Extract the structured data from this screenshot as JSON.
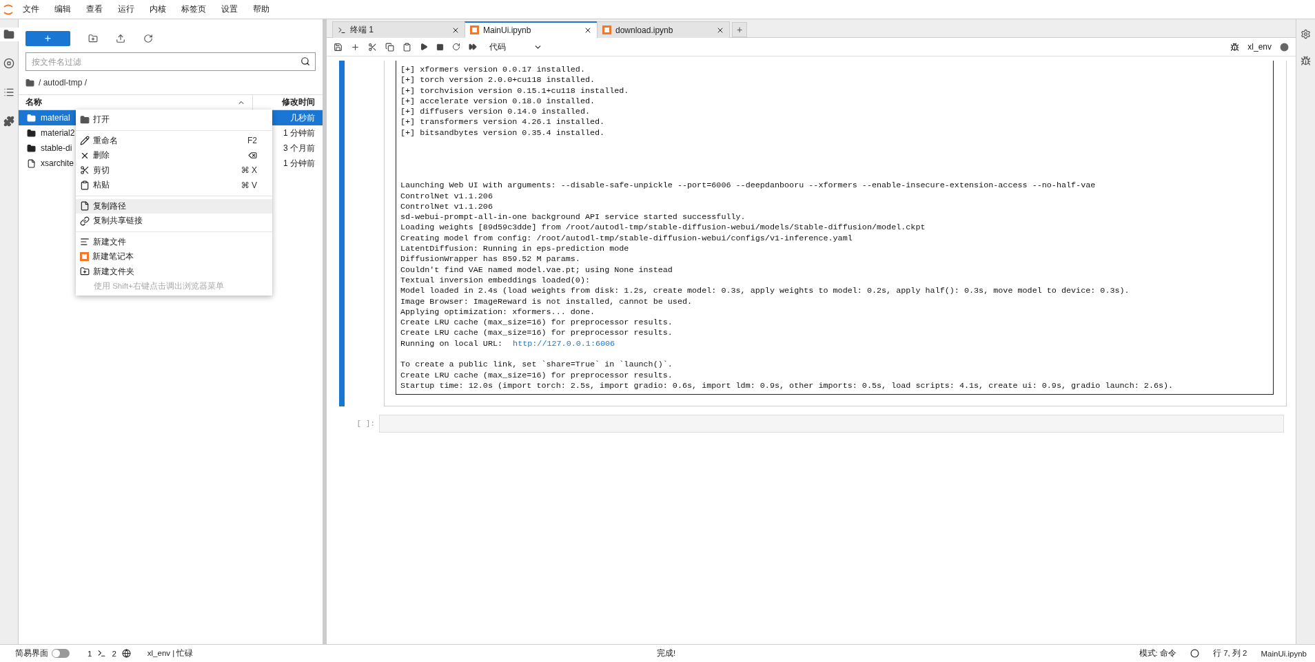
{
  "menu_bar": [
    "文件",
    "编辑",
    "查看",
    "运行",
    "内核",
    "标签页",
    "设置",
    "帮助"
  ],
  "left_sidebar": [
    {
      "kind": "files",
      "selected": true
    },
    {
      "kind": "running",
      "selected": false
    },
    {
      "kind": "toc",
      "selected": false
    },
    {
      "kind": "extensions",
      "selected": false
    }
  ],
  "file_browser": {
    "new_button": "+",
    "filter": {
      "placeholder": "按文件名过滤"
    },
    "breadcrumb": "/ autodl-tmp /",
    "columns": [
      "名称",
      "修改时间"
    ],
    "rows": [
      {
        "name": "material",
        "time": "几秒前",
        "kind": "folder",
        "selected": true
      },
      {
        "name": "material2",
        "time": "1 分钟前",
        "kind": "folder",
        "selected": false
      },
      {
        "name": "stable-di",
        "time": "3 个月前",
        "kind": "folder",
        "selected": false
      },
      {
        "name": "xsarchite",
        "time": "1 分钟前",
        "kind": "file",
        "selected": false
      }
    ]
  },
  "context_menu": {
    "groups": [
      [
        {
          "kind": "open",
          "label": "打开",
          "highlighted": false
        }
      ],
      [
        {
          "kind": "rename",
          "label": "重命名",
          "shortcut": "F2",
          "highlighted": false
        },
        {
          "kind": "delete",
          "label": "删除",
          "highlighted": false
        },
        {
          "kind": "cut",
          "label": "剪切",
          "shortcut": "⌘ X",
          "highlighted": false
        },
        {
          "kind": "paste",
          "label": "粘贴",
          "shortcut": "⌘ V",
          "highlighted": false
        }
      ],
      [
        {
          "kind": "copy-path",
          "label": "复制路径",
          "highlighted": true
        },
        {
          "kind": "share-link",
          "label": "复制共享链接",
          "highlighted": false
        }
      ],
      [
        {
          "kind": "new-file",
          "label": "新建文件",
          "highlighted": false
        },
        {
          "kind": "new-notebook",
          "label": "新建笔记本",
          "highlighted": false
        },
        {
          "kind": "new-folder",
          "label": "新建文件夹",
          "highlighted": false
        }
      ]
    ],
    "hint": "使用 Shift+右键点击调出浏览器菜单"
  },
  "tabs": [
    {
      "label": "终端 1",
      "kind": "terminal",
      "selected": false
    },
    {
      "label": "MainUi.ipynb",
      "kind": "notebook",
      "selected": true
    },
    {
      "label": "download.ipynb",
      "kind": "notebook",
      "selected": false
    }
  ],
  "new_tab_button": "+",
  "notebook_toolbar": {
    "cell_type": "代码",
    "kernel": "xl_env",
    "kernel_busy": true
  },
  "output_blocks": [
    {
      "lines": [
        {
          "text": "[+] xformers version 0.0.17 installed."
        },
        {
          "text": "[+] torch version 2.0.0+cu118 installed."
        },
        {
          "text": "[+] torchvision version 0.15.1+cu118 installed."
        },
        {
          "text": "[+] accelerate version 0.18.0 installed."
        },
        {
          "text": "[+] diffusers version 0.14.0 installed."
        },
        {
          "text": "[+] transformers version 4.26.1 installed."
        },
        {
          "text": "[+] bitsandbytes version 0.35.4 installed."
        }
      ]
    },
    {
      "lines": [
        {
          "text": "Launching Web UI with arguments: --disable-safe-unpickle --port=6006 --deepdanbooru --xformers --enable-insecure-extension-access --no-half-vae"
        },
        {
          "text": "ControlNet v1.1.206"
        },
        {
          "text": "ControlNet v1.1.206"
        },
        {
          "text": "sd-webui-prompt-all-in-one background API service started successfully."
        },
        {
          "text": "Loading weights [89d59c3dde] from /root/autodl-tmp/stable-diffusion-webui/models/Stable-diffusion/model.ckpt"
        },
        {
          "text": "Creating model from config: /root/autodl-tmp/stable-diffusion-webui/configs/v1-inference.yaml"
        },
        {
          "text": "LatentDiffusion: Running in eps-prediction mode"
        },
        {
          "text": "DiffusionWrapper has 859.52 M params."
        },
        {
          "text": "Couldn't find VAE named model.vae.pt; using None instead"
        },
        {
          "text": "Textual inversion embeddings loaded(0):"
        },
        {
          "text": "Model loaded in 2.4s (load weights from disk: 1.2s, create model: 0.3s, apply weights to model: 0.2s, apply half(): 0.3s, move model to device: 0.3s)."
        },
        {
          "text": "Image Browser: ImageReward is not installed, cannot be used."
        },
        {
          "text": "Applying optimization: xformers... done."
        },
        {
          "text": "Create LRU cache (max_size=16) for preprocessor results."
        },
        {
          "text": "Create LRU cache (max_size=16) for preprocessor results."
        },
        {
          "text": "Running on local URL:",
          "link": "http://127.0.0.1:6006"
        }
      ]
    },
    {
      "lines": [
        {
          "text": "To create a public link, set `share=True` in `launch()`."
        },
        {
          "text": "Create LRU cache (max_size=16) for preprocessor results."
        },
        {
          "text": "Startup time: 12.0s (import torch: 2.5s, import gradio: 0.6s, import ldm: 0.9s, other imports: 0.5s, load scripts: 4.1s, create ui: 0.9s, gradio launch: 2.6s)."
        }
      ]
    }
  ],
  "empty_cell": {
    "prompt": "[ ]:"
  },
  "right_sidebar": [
    {
      "kind": "property-inspector"
    },
    {
      "kind": "debugger"
    }
  ],
  "status_bar": {
    "simple_mode_label": "简易界面",
    "simple_mode": false,
    "terminals": "1",
    "kernels": "2",
    "kernel_status": "xl_env | 忙碌",
    "message": "完成!",
    "mode": "模式: 命令",
    "position": "行 7, 列 2",
    "file": "MainUi.ipynb"
  }
}
